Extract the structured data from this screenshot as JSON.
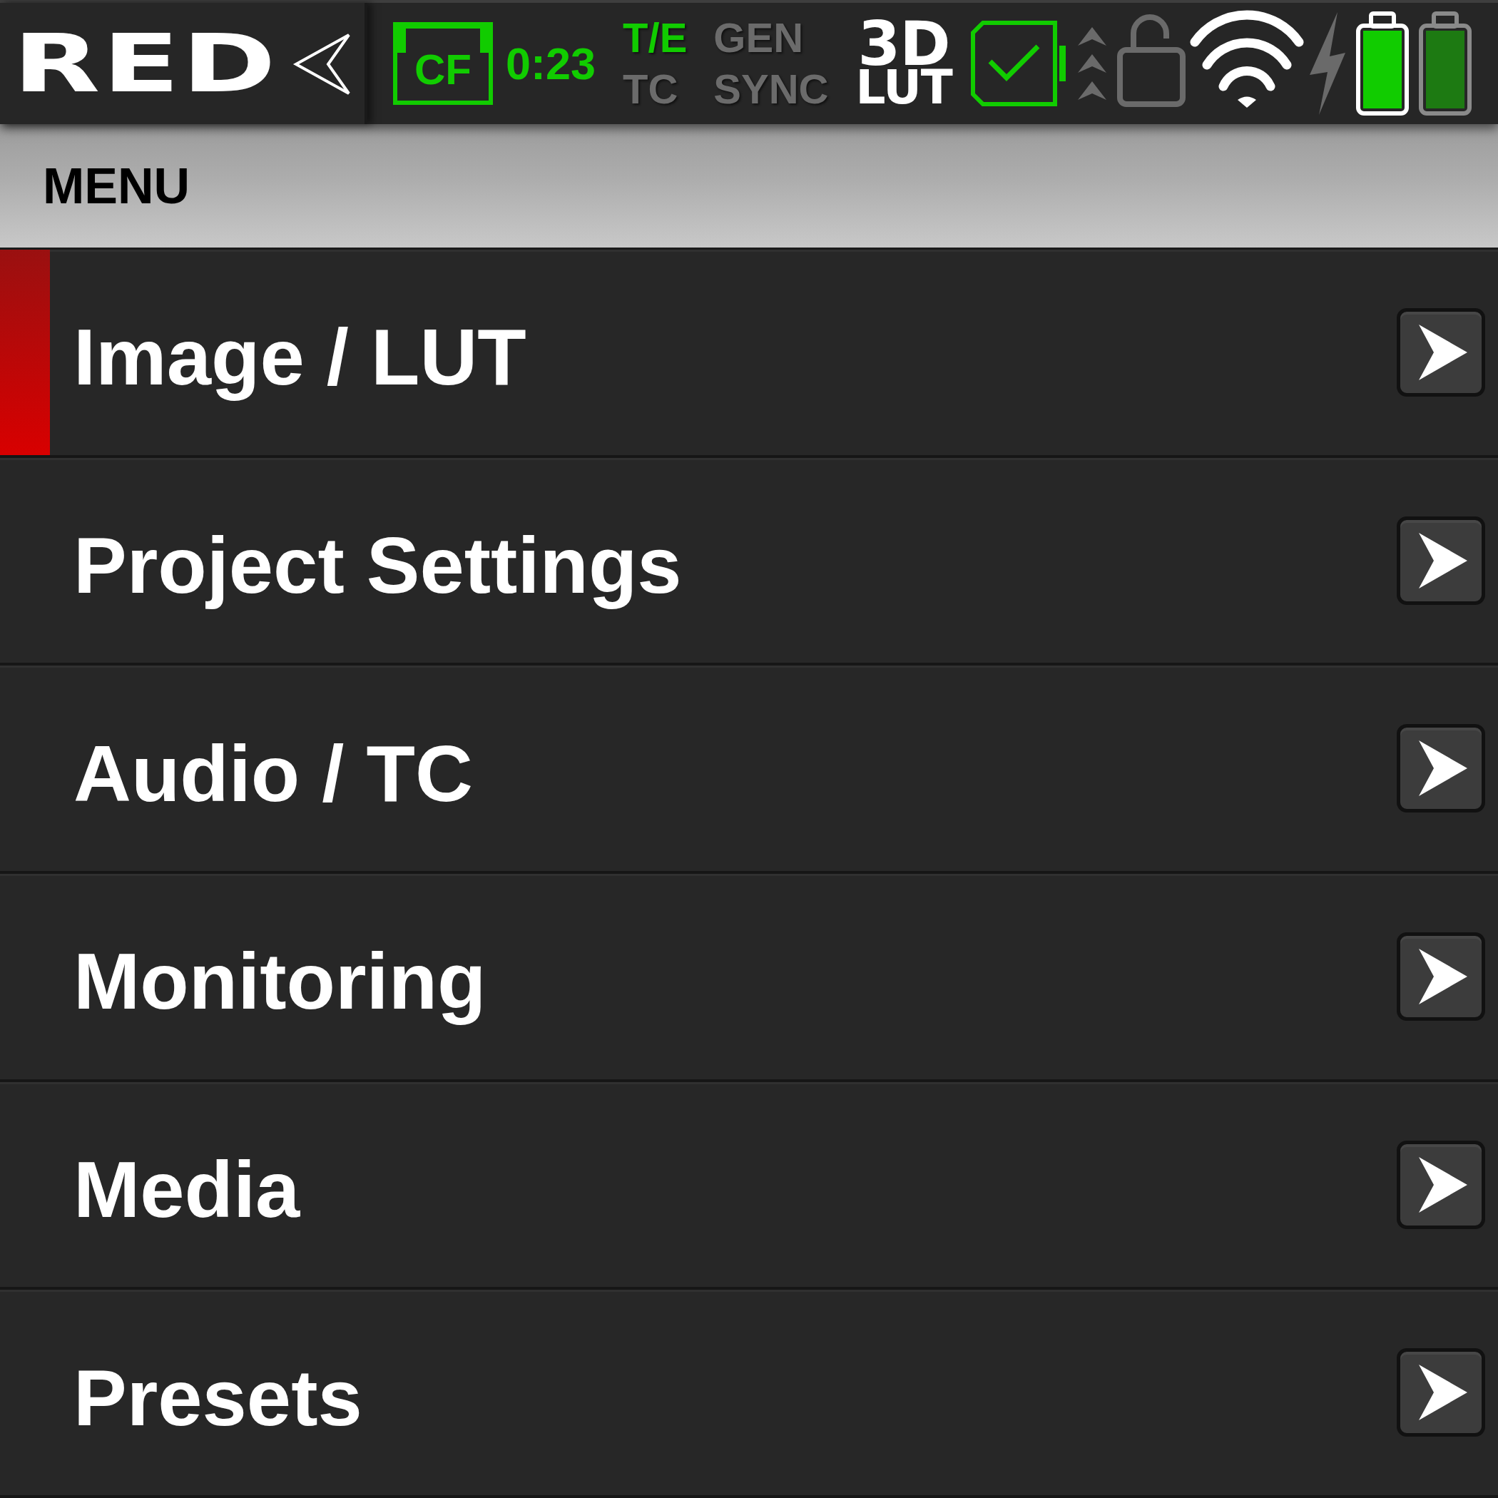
{
  "status_bar": {
    "logo": "RED",
    "media": {
      "label": "CF",
      "time": "0:23"
    },
    "timecode_flags": [
      {
        "label": "T/E",
        "on": true
      },
      {
        "label": "TC",
        "on": false
      }
    ],
    "sync_flags": [
      {
        "label": "GEN",
        "on": false
      },
      {
        "label": "SYNC",
        "on": false
      }
    ],
    "lut": {
      "lines": [
        "3D",
        "LUT"
      ],
      "on": true
    },
    "lock": {
      "locked": false
    },
    "batteries": [
      {
        "active": true
      },
      {
        "active": false
      }
    ]
  },
  "menu": {
    "title": "MENU",
    "items": [
      {
        "label": "Image / LUT",
        "selected": true
      },
      {
        "label": "Project Settings",
        "selected": false
      },
      {
        "label": "Audio / TC",
        "selected": false
      },
      {
        "label": "Monitoring",
        "selected": false
      },
      {
        "label": "Media",
        "selected": false
      },
      {
        "label": "Presets",
        "selected": false
      }
    ]
  }
}
